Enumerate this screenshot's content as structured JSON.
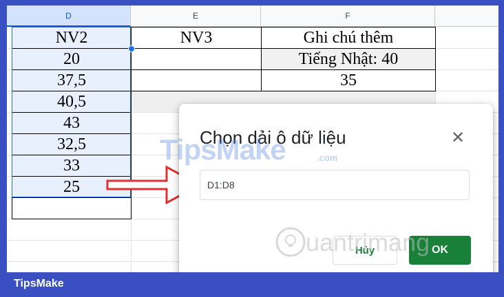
{
  "columns": [
    {
      "letter": "D",
      "selected": true
    },
    {
      "letter": "E",
      "selected": false
    },
    {
      "letter": "F",
      "selected": false
    }
  ],
  "column_d": [
    "NV2",
    "20",
    "37,5",
    "40,5",
    "43",
    "32,5",
    "33",
    "25"
  ],
  "column_e": [
    "NV3"
  ],
  "column_f": [
    "Ghi chú thêm",
    "Tiếng Nhật: 40",
    "35"
  ],
  "dialog": {
    "title": "Chọn dải ô dữ liệu",
    "close_glyph": "✕",
    "range_value": "D1:D8",
    "cancel_label": "Hủy",
    "ok_label": "OK"
  },
  "watermarks": {
    "tipsmake_big": "TipsMake",
    "tipsmake_com": ".com",
    "quantrimang": "uantrimang"
  },
  "footer": {
    "logo": "TipsMake"
  },
  "colors": {
    "accent": "#1a73e8",
    "ok_green": "#188038",
    "frame_blue": "#3a4fc1",
    "arrow_red": "#e03030"
  }
}
